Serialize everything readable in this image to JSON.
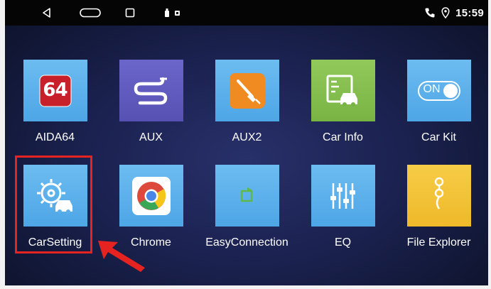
{
  "status_bar": {
    "time": "15:59",
    "icons": [
      "back-icon",
      "home-icon",
      "recents-icon",
      "usb-icon",
      "notification-icon",
      "phone-icon",
      "location-icon"
    ]
  },
  "apps": [
    {
      "label": "AIDA64",
      "icon": "aida64-icon",
      "row": 1
    },
    {
      "label": "AUX",
      "icon": "aux-cable-icon",
      "row": 1
    },
    {
      "label": "AUX2",
      "icon": "aux2-cable-icon",
      "row": 1
    },
    {
      "label": "Car Info",
      "icon": "car-info-icon",
      "row": 1
    },
    {
      "label": "Car Kit",
      "icon": "toggle-on-icon",
      "row": 1
    },
    {
      "label": "CarSetting",
      "icon": "car-setting-gear-icon",
      "row": 2
    },
    {
      "label": "Chrome",
      "icon": "chrome-icon",
      "row": 2
    },
    {
      "label": "EasyConnection",
      "icon": "easy-connection-icon",
      "row": 2
    },
    {
      "label": "EQ",
      "icon": "equalizer-icon",
      "row": 2
    },
    {
      "label": "File Explorer",
      "icon": "folder-icon",
      "row": 2
    }
  ],
  "badges": {
    "aida_text": "64",
    "carkit_toggle": "ON"
  },
  "annotation": {
    "highlight_color": "#e52320",
    "arrow_color": "#e52320",
    "target": "CarSetting"
  },
  "colors": {
    "tile_blue": "#5aaee9",
    "tile_purple": "#5e59bd",
    "tile_yellow": "#f3c336",
    "status_bar": "#050505",
    "wallpaper": "#1b2250"
  }
}
